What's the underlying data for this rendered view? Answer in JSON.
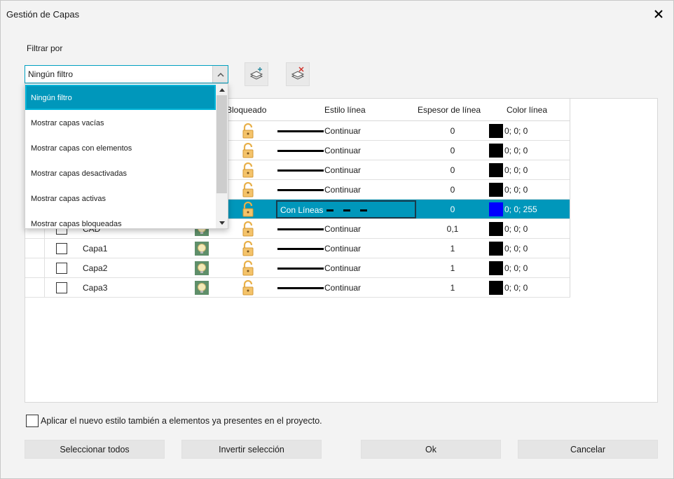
{
  "window": {
    "title": "Gestión de Capas"
  },
  "filter": {
    "label": "Filtrar por",
    "value": "Ningún filtro",
    "options": [
      "Ningún filtro",
      "Mostrar capas vacías",
      "Mostrar capas con elementos",
      "Mostrar capas desactivadas",
      "Mostrar capas activas",
      "Mostrar capas bloqueadas"
    ]
  },
  "toolbar": {
    "add_icon": "layer-add-icon",
    "delete_icon": "layer-delete-icon"
  },
  "columns": {
    "locked": "Bloqueado",
    "line_style": "Estilo línea",
    "line_thickness": "Espesor de línea",
    "line_color": "Color línea"
  },
  "rows": [
    {
      "name": "",
      "style": "Continuar",
      "thickness": "0",
      "color": "0; 0; 0",
      "swatch": "#000000"
    },
    {
      "name": "",
      "style": "Continuar",
      "thickness": "0",
      "color": "0; 0; 0",
      "swatch": "#000000"
    },
    {
      "name": "",
      "style": "Continuar",
      "thickness": "0",
      "color": "0; 0; 0",
      "swatch": "#000000"
    },
    {
      "name": "",
      "style": "Continuar",
      "thickness": "0",
      "color": "0; 0; 0",
      "swatch": "#000000"
    },
    {
      "name": "",
      "style": "Con Líneas",
      "thickness": "0",
      "color": "0; 0; 255",
      "swatch": "#0000ff",
      "selected": true
    },
    {
      "name": "CAD",
      "style": "Continuar",
      "thickness": "0,1",
      "color": "0; 0; 0",
      "swatch": "#000000"
    },
    {
      "name": "Capa1",
      "style": "Continuar",
      "thickness": "1",
      "color": "0; 0; 0",
      "swatch": "#000000"
    },
    {
      "name": "Capa2",
      "style": "Continuar",
      "thickness": "1",
      "color": "0; 0; 0",
      "swatch": "#000000"
    },
    {
      "name": "Capa3",
      "style": "Continuar",
      "thickness": "1",
      "color": "0; 0; 0",
      "swatch": "#000000"
    }
  ],
  "apply_existing": {
    "label": "Aplicar el nuevo estilo también a elementos ya presentes en el proyecto.",
    "checked": false
  },
  "buttons": {
    "select_all": "Seleccionar todos",
    "invert": "Invertir selección",
    "ok": "Ok",
    "cancel": "Cancelar"
  },
  "colors": {
    "accent": "#0097bb",
    "focus": "#00a0c0"
  }
}
